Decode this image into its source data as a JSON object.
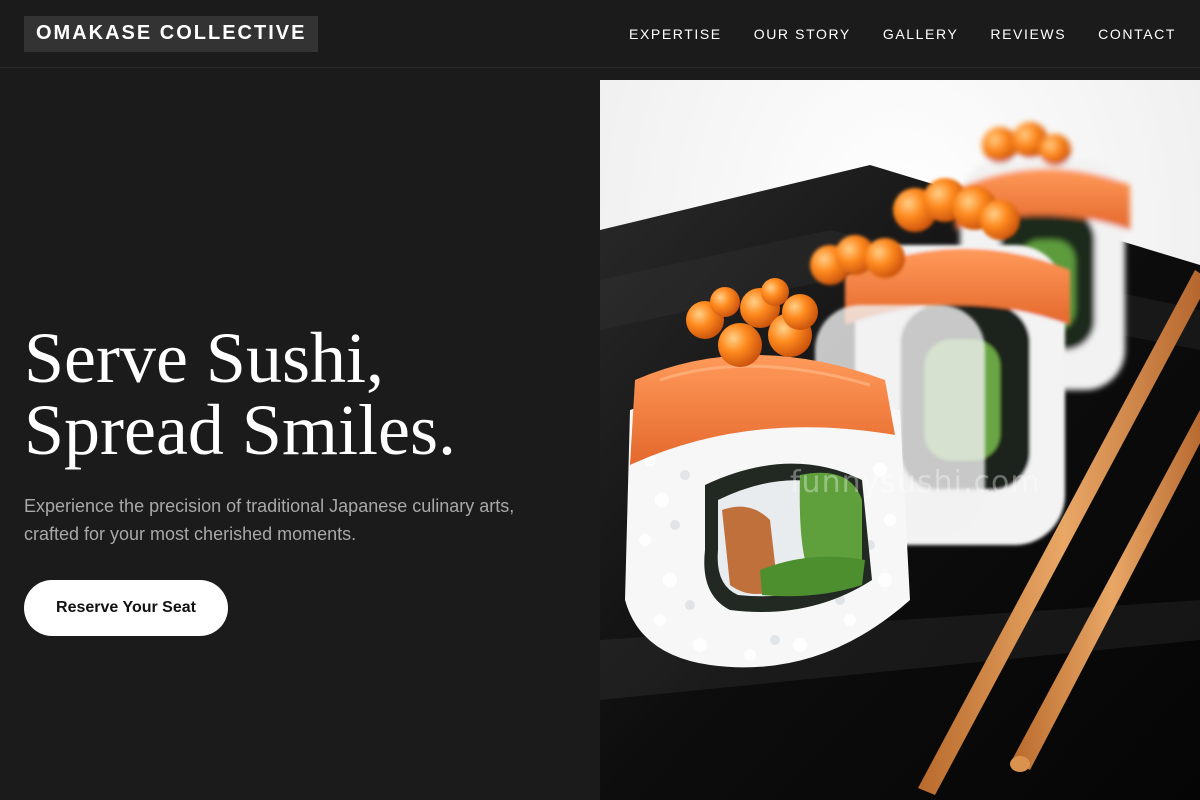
{
  "header": {
    "brand": "OMAKASE COLLECTIVE",
    "nav": [
      {
        "label": "EXPERTISE"
      },
      {
        "label": "OUR STORY"
      },
      {
        "label": "GALLERY"
      },
      {
        "label": "REVIEWS"
      },
      {
        "label": "CONTACT"
      }
    ]
  },
  "hero": {
    "headline_line1": "Serve Sushi,",
    "headline_line2": "Spread Smiles.",
    "subtext": "Experience the precision of traditional Japanese culinary arts, crafted for your most cherished moments.",
    "cta_label": "Reserve Your Seat"
  },
  "photo": {
    "watermark": "funnysushi.com",
    "alt": "sushi-rolls-with-salmon-roe-and-chopsticks"
  },
  "colors": {
    "background": "#1b1b1b",
    "text": "#ffffff",
    "muted_text": "#a8a8a8",
    "button_bg": "#ffffff",
    "brand_bg": "#333333"
  }
}
